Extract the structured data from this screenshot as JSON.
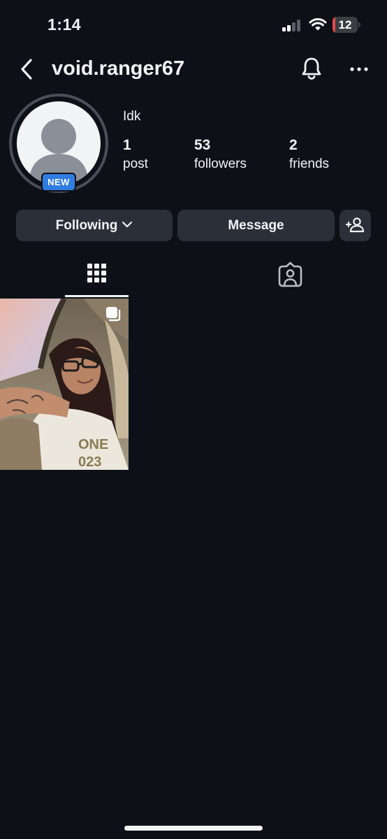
{
  "status_bar": {
    "time": "1:14",
    "battery_level": "12",
    "battery_fraction": 0.12,
    "battery_color": "#e5484d",
    "signal_bars_active": 2,
    "signal_bars_total": 4
  },
  "header": {
    "username": "void.ranger67",
    "icons": [
      "chevron-left-icon",
      "bell-icon",
      "more-horizontal-icon"
    ]
  },
  "profile": {
    "avatar_badge": "NEW",
    "bio": "Idk",
    "stats": [
      {
        "value": "1",
        "label": "post"
      },
      {
        "value": "53",
        "label": "followers"
      },
      {
        "value": "2",
        "label": "friends"
      }
    ]
  },
  "actions": {
    "following_label": "Following",
    "message_label": "Message",
    "add_user_icon": "add-user-icon"
  },
  "tabs": [
    {
      "icon": "grid-icon",
      "selected": true
    },
    {
      "icon": "tagged-person-icon",
      "selected": false
    }
  ],
  "posts": [
    {
      "type": "carousel",
      "icon": "multiple-posts-icon"
    }
  ],
  "colors": {
    "background": "#0d1117",
    "button": "#2b3038",
    "badge": "#2f7de1",
    "text": "#f1f3f5"
  }
}
